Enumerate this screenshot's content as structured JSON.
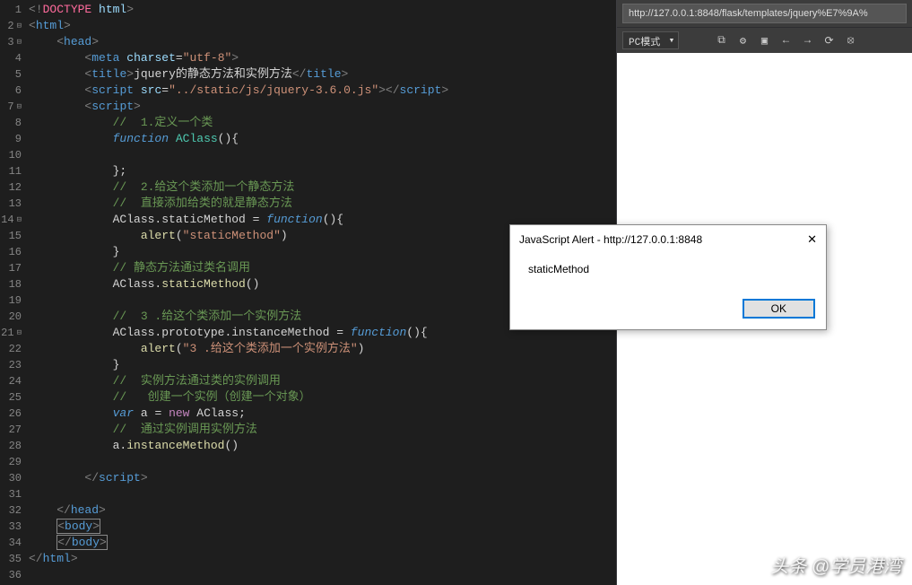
{
  "editor": {
    "lines": [
      {
        "n": 1,
        "fold": "",
        "html": "<span class='c-bracket'>&lt;!</span><span class='c-pink'>DOCTYPE</span> <span class='c-attr'>html</span><span class='c-bracket'>&gt;</span>"
      },
      {
        "n": 2,
        "fold": "⊟",
        "html": "<span class='c-bracket'>&lt;</span><span class='c-tag'>html</span><span class='c-bracket'>&gt;</span>"
      },
      {
        "n": 3,
        "fold": "⊟",
        "html": "    <span class='c-bracket'>&lt;</span><span class='c-tag'>head</span><span class='c-bracket'>&gt;</span>"
      },
      {
        "n": 4,
        "fold": "",
        "html": "        <span class='c-bracket'>&lt;</span><span class='c-tag'>meta</span> <span class='c-attr'>charset</span><span class='c-default'>=</span><span class='c-string'>\"utf-8\"</span><span class='c-bracket'>&gt;</span>"
      },
      {
        "n": 5,
        "fold": "",
        "html": "        <span class='c-bracket'>&lt;</span><span class='c-tag'>title</span><span class='c-bracket'>&gt;</span><span class='c-default'>jquery的静态方法和实例方法</span><span class='c-bracket'>&lt;/</span><span class='c-tag'>title</span><span class='c-bracket'>&gt;</span>"
      },
      {
        "n": 6,
        "fold": "",
        "html": "        <span class='c-bracket'>&lt;</span><span class='c-tag'>script</span> <span class='c-attr'>src</span><span class='c-default'>=</span><span class='c-string'>\"../static/js/jquery-3.6.0.js\"</span><span class='c-bracket'>&gt;&lt;/</span><span class='c-tag'>script</span><span class='c-bracket'>&gt;</span>"
      },
      {
        "n": 7,
        "fold": "⊟",
        "html": "        <span class='c-bracket'>&lt;</span><span class='c-tag'>script</span><span class='c-bracket'>&gt;</span>"
      },
      {
        "n": 8,
        "fold": "",
        "html": "            <span class='c-comment'>//  1.定义一个类</span>"
      },
      {
        "n": 9,
        "fold": "",
        "html": "            <span class='c-keyword'>function</span> <span class='c-class'>AClass</span><span class='c-default'>(){</span>"
      },
      {
        "n": 10,
        "fold": "",
        "html": ""
      },
      {
        "n": 11,
        "fold": "",
        "html": "            <span class='c-default'>};</span>"
      },
      {
        "n": 12,
        "fold": "",
        "html": "            <span class='c-comment'>//  2.给这个类添加一个静态方法</span>"
      },
      {
        "n": 13,
        "fold": "",
        "html": "            <span class='c-comment'>//  直接添加给类的就是静态方法</span>"
      },
      {
        "n": 14,
        "fold": "⊟",
        "html": "            <span class='c-default'>AClass.staticMethod = </span><span class='c-keyword'>function</span><span class='c-default'>(){</span>"
      },
      {
        "n": 15,
        "fold": "",
        "html": "                <span class='c-func'>alert</span><span class='c-default'>(</span><span class='c-string'>\"staticMethod\"</span><span class='c-default'>)</span>"
      },
      {
        "n": 16,
        "fold": "",
        "html": "            <span class='c-default'>}</span>"
      },
      {
        "n": 17,
        "fold": "",
        "html": "            <span class='c-comment'>// 静态方法通过类名调用</span>"
      },
      {
        "n": 18,
        "fold": "",
        "html": "            <span class='c-default'>AClass.</span><span class='c-func'>staticMethod</span><span class='c-default'>()</span>"
      },
      {
        "n": 19,
        "fold": "",
        "html": ""
      },
      {
        "n": 20,
        "fold": "",
        "html": "            <span class='c-comment'>//  3 .给这个类添加一个实例方法</span>"
      },
      {
        "n": 21,
        "fold": "⊟",
        "html": "            <span class='c-default'>AClass.prototype.instanceMethod = </span><span class='c-keyword'>function</span><span class='c-default'>(){</span>"
      },
      {
        "n": 22,
        "fold": "",
        "html": "                <span class='c-func'>alert</span><span class='c-default'>(</span><span class='c-string'>\"3 .给这个类添加一个实例方法\"</span><span class='c-default'>)</span>"
      },
      {
        "n": 23,
        "fold": "",
        "html": "            <span class='c-default'>}</span>"
      },
      {
        "n": 24,
        "fold": "",
        "html": "            <span class='c-comment'>//  实例方法通过类的实例调用</span>"
      },
      {
        "n": 25,
        "fold": "",
        "html": "            <span class='c-comment'>//   创建一个实例（创建一个对象）</span>"
      },
      {
        "n": 26,
        "fold": "",
        "html": "            <span class='c-keyword'>var</span> <span class='c-default'>a = </span><span class='c-keyword2'>new</span> <span class='c-default'>AClass;</span>"
      },
      {
        "n": 27,
        "fold": "",
        "html": "            <span class='c-comment'>//  通过实例调用实例方法</span>"
      },
      {
        "n": 28,
        "fold": "",
        "html": "            <span class='c-default'>a.</span><span class='c-func'>instanceMethod</span><span class='c-default'>()</span>"
      },
      {
        "n": 29,
        "fold": "",
        "html": ""
      },
      {
        "n": 30,
        "fold": "",
        "html": "        <span class='c-bracket'>&lt;/</span><span class='c-tag'>script</span><span class='c-bracket'>&gt;</span>"
      },
      {
        "n": 31,
        "fold": "",
        "html": ""
      },
      {
        "n": 32,
        "fold": "",
        "html": "    <span class='c-bracket'>&lt;/</span><span class='c-tag'>head</span><span class='c-bracket'>&gt;</span>"
      },
      {
        "n": 33,
        "fold": "",
        "html": "    <span class='sel-box'><span class='c-bracket'>&lt;</span><span class='c-tag'>body</span><span class='c-bracket'>&gt;</span></span>"
      },
      {
        "n": 34,
        "fold": "",
        "html": "    <span class='sel-box'><span class='c-bracket'>&lt;/</span><span class='c-tag'>body</span><span class='c-bracket'>&gt;</span></span>"
      },
      {
        "n": 35,
        "fold": "",
        "html": "<span class='c-bracket'>&lt;/</span><span class='c-tag'>html</span><span class='c-bracket'>&gt;</span>"
      },
      {
        "n": 36,
        "fold": "",
        "html": ""
      }
    ]
  },
  "browser": {
    "url": "http://127.0.0.1:8848/flask/templates/jquery%E7%9A%",
    "mode": "PC模式"
  },
  "alert": {
    "title": "JavaScript Alert - http://127.0.0.1:8848",
    "message": "staticMethod",
    "ok": "OK"
  },
  "watermark": "头条 @学员港湾"
}
